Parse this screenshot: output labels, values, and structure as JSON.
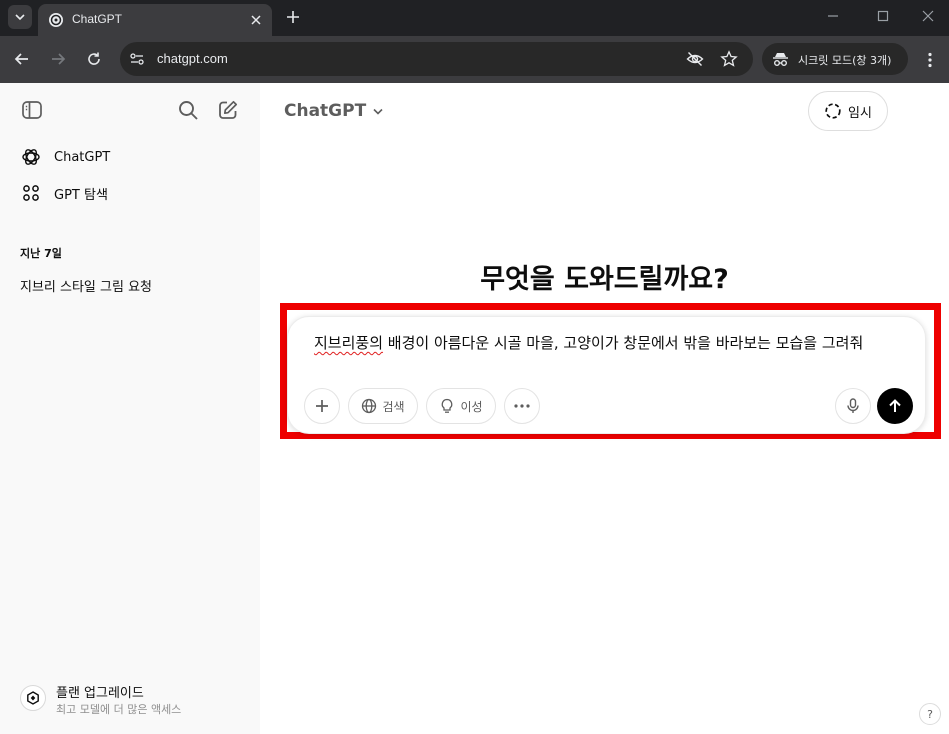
{
  "browser": {
    "tab_title": "ChatGPT",
    "url": "chatgpt.com",
    "incognito_label": "시크릿 모드(창 3개)"
  },
  "sidebar": {
    "items": [
      {
        "label": "ChatGPT",
        "icon": "openai-logo-icon"
      },
      {
        "label": "GPT 탐색",
        "icon": "grid-icon"
      }
    ],
    "section_title": "지난 7일",
    "history": [
      "지브리 스타일 그림 요청"
    ],
    "upgrade": {
      "title": "플랜 업그레이드",
      "subtitle": "최고 모델에 더 많은 액세스"
    }
  },
  "main": {
    "model_name": "ChatGPT",
    "temporary_label": "임시",
    "headline": "무엇을 도와드릴까요?",
    "composer": {
      "prompt_underlined": "지브리풍의",
      "prompt_rest": " 배경이 아름다운 시골 마을, 고양이가 창문에서 밖을 바라보는 모습을 그려줘",
      "search_label": "검색",
      "reason_label": "이성"
    },
    "help_label": "?"
  },
  "colors": {
    "highlight": "#ee0000",
    "sidebar_bg": "#f9f9f9",
    "browser_chrome": "#3c3c3f"
  }
}
